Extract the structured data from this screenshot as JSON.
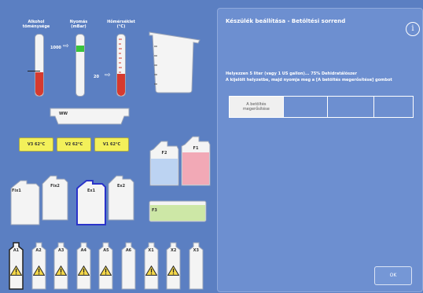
{
  "gauges": {
    "alcohol": {
      "label_line1": "Alkohol",
      "label_line2": "töménysége"
    },
    "pressure": {
      "label_line1": "Nyomás",
      "label_line2": "(mBar)",
      "value": "1000"
    },
    "temperature": {
      "label_line1": "Hőmérséklet",
      "label_line2": "(°C)",
      "value": "20"
    }
  },
  "wax_bath": {
    "label": "WW"
  },
  "heaters": [
    {
      "label": "V3  62°C"
    },
    {
      "label": "V2  62°C"
    },
    {
      "label": "V1  62°C"
    }
  ],
  "flush_bottles": [
    {
      "label": "F2"
    },
    {
      "label": "F1"
    },
    {
      "label": "F3"
    }
  ],
  "fix_bottles": [
    {
      "label": "Fix1"
    },
    {
      "label": "Fix2"
    },
    {
      "label": "Ex1"
    },
    {
      "label": "Ex2"
    }
  ],
  "reagent_bottles": [
    {
      "label": "A1",
      "warning": true
    },
    {
      "label": "A2",
      "warning": true
    },
    {
      "label": "A3",
      "warning": true
    },
    {
      "label": "A4",
      "warning": true
    },
    {
      "label": "A5",
      "warning": true
    },
    {
      "label": "A6",
      "warning": false
    },
    {
      "label": "X1",
      "warning": true
    },
    {
      "label": "X2",
      "warning": true
    },
    {
      "label": "X3",
      "warning": false
    }
  ],
  "dialog": {
    "title": "Készülék beállítása - Betöltési sorrend",
    "instruction_line1": "Helyezzen 5 liter (vagy 1 US gallon)... 75% Dehidratálószer",
    "instruction_line2": "A kijelölt helyzetbe, majd nyomja meg a [A betöltés megerősítése] gombot",
    "confirm_cell_line1": "A betöltés",
    "confirm_cell_line2": "megerősítése",
    "ok_label": "OK"
  },
  "colors": {
    "background": "#5b7fc2",
    "dialog": "#6d8fd0",
    "heater": "#f3f05a",
    "flush_blue": "#bcd3f2",
    "flush_pink": "#f2a9b6",
    "flush_green": "#cde7a6",
    "alcohol_fill": "#d63a2f",
    "pressure_fill": "#39c43c",
    "temperature_fill": "#d63a2f"
  }
}
